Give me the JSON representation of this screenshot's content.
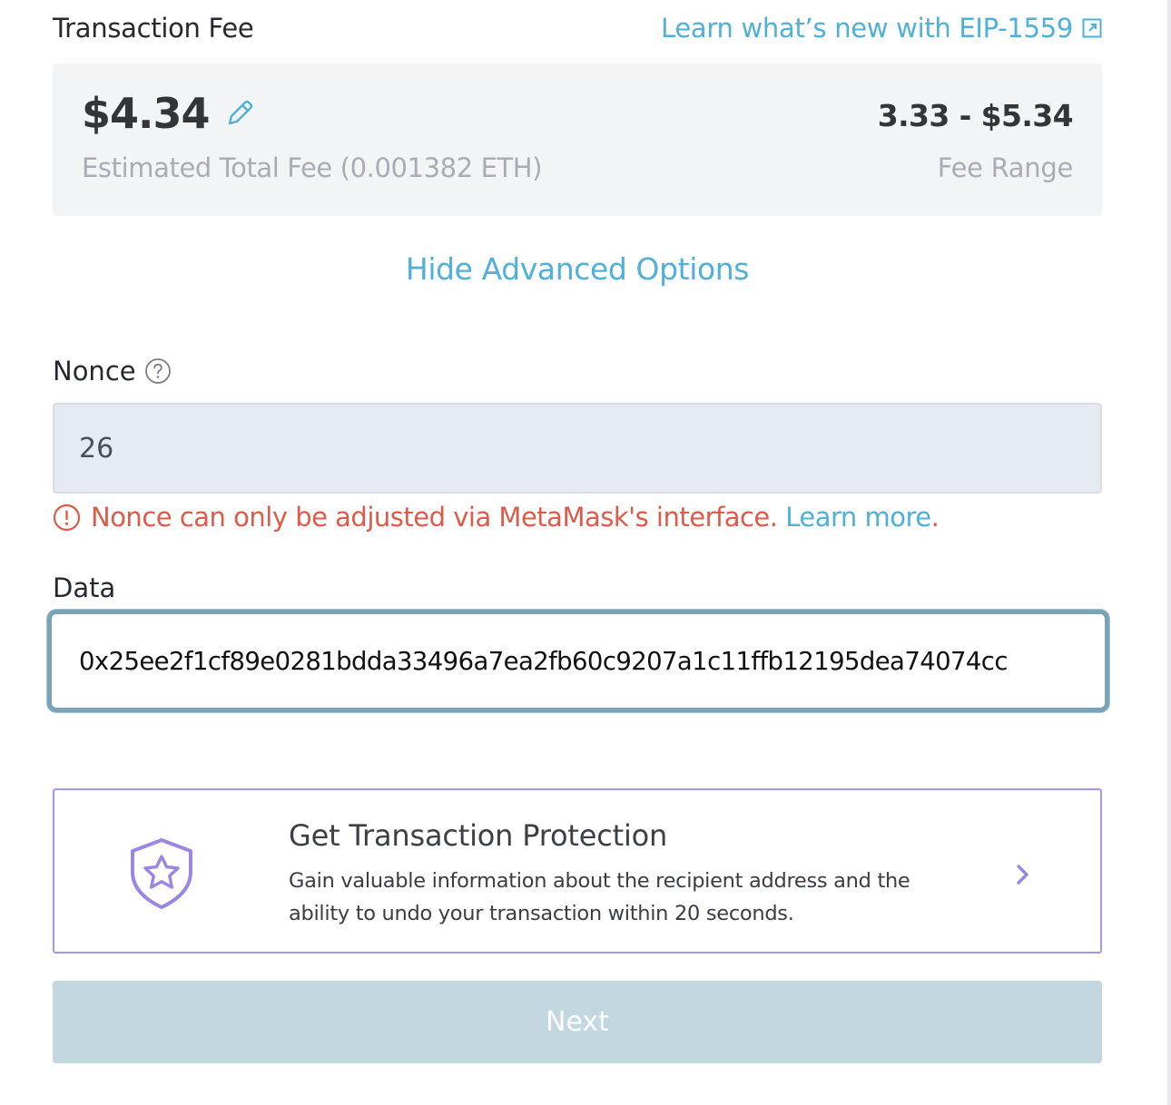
{
  "header": {
    "title": "Transaction Fee",
    "eip_link": "Learn what’s new with EIP-1559"
  },
  "fee": {
    "amount": "$4.34",
    "estimate_label": "Estimated Total Fee (0.001382 ETH)",
    "range": "3.33 - $5.34",
    "range_label": "Fee Range"
  },
  "advanced_toggle": "Hide Advanced Options",
  "nonce": {
    "label": "Nonce",
    "value": "26",
    "error_text": "Nonce can only be adjusted via MetaMask's interface.",
    "learn_more": "Learn more",
    "error_period": "."
  },
  "data_field": {
    "label": "Data",
    "value": "0x25ee2f1cf89e0281bdda33496a7ea2fb60c9207a1c11ffb12195dea74074cc"
  },
  "protection": {
    "title": "Get Transaction Protection",
    "description": "Gain valuable information about the recipient address and the ability to undo your transaction within 20 seconds."
  },
  "next_button": "Next",
  "colors": {
    "link": "#4fb0da",
    "error": "#e05a4a",
    "focus_border": "#7aa3b8",
    "protection_accent": "#a995e8",
    "next_disabled": "#c2d7df"
  },
  "icons": {
    "external": "external-link-icon",
    "edit": "pencil-icon",
    "help": "question-circle-icon",
    "error": "exclamation-circle-icon",
    "shield": "shield-star-icon",
    "chevron": "chevron-right-icon"
  }
}
